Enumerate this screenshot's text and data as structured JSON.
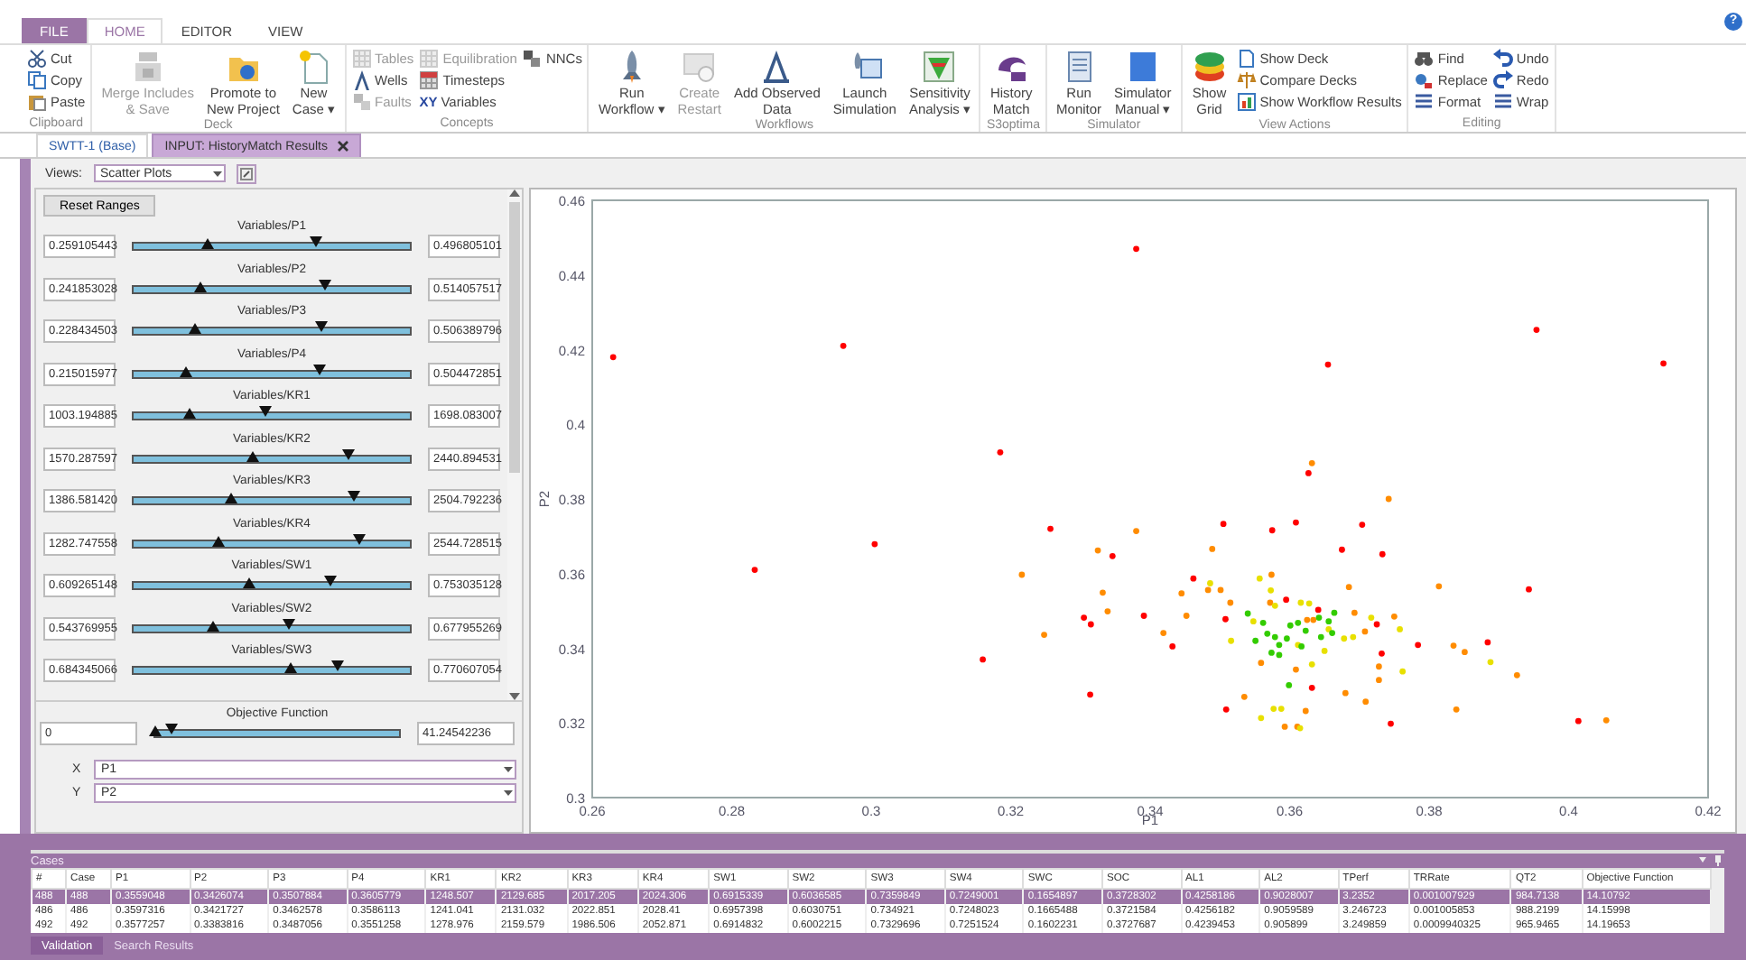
{
  "menu_tabs": [
    {
      "label": "FILE",
      "kind": "file",
      "selected": false
    },
    {
      "label": "HOME",
      "kind": "tab",
      "selected": true
    },
    {
      "label": "EDITOR",
      "kind": "tab",
      "selected": false
    },
    {
      "label": "VIEW",
      "kind": "tab",
      "selected": false
    }
  ],
  "help": "?",
  "ribbon": {
    "groups": [
      {
        "label": "Clipboard",
        "items": [
          {
            "kind": "stack",
            "items": [
              {
                "label": "Cut",
                "disabled": false
              },
              {
                "label": "Copy",
                "disabled": false
              },
              {
                "label": "Paste",
                "disabled": false
              }
            ]
          }
        ]
      },
      {
        "label": "Deck",
        "items": [
          {
            "kind": "large",
            "label": "Merge Includes\n& Save",
            "disabled": true
          },
          {
            "kind": "large",
            "label": "Promote to\nNew Project",
            "disabled": false
          },
          {
            "kind": "large",
            "label": "New\nCase ▾",
            "disabled": false
          }
        ]
      },
      {
        "label": "Concepts",
        "items": [
          {
            "kind": "stack",
            "items": [
              {
                "label": "Tables",
                "disabled": true
              },
              {
                "label": "Wells",
                "disabled": false
              },
              {
                "label": "Faults",
                "disabled": true
              }
            ]
          },
          {
            "kind": "stack",
            "items": [
              {
                "label": "Equilibration",
                "disabled": true
              },
              {
                "label": "Timesteps",
                "disabled": false
              },
              {
                "label": "Variables",
                "disabled": false,
                "glyph": "XY"
              }
            ]
          },
          {
            "kind": "stack",
            "items": [
              {
                "label": "NNCs",
                "disabled": false
              }
            ]
          }
        ]
      },
      {
        "label": "Workflows",
        "items": [
          {
            "kind": "large",
            "label": "Run\nWorkflow ▾",
            "disabled": false
          },
          {
            "kind": "large",
            "label": "Create\nRestart",
            "disabled": true
          },
          {
            "kind": "large",
            "label": "Add Observed\nData",
            "disabled": false
          },
          {
            "kind": "large",
            "label": "Launch\nSimulation",
            "disabled": false
          },
          {
            "kind": "large",
            "label": "Sensitivity\nAnalysis ▾",
            "disabled": false
          }
        ]
      },
      {
        "label": "S3optima",
        "items": [
          {
            "kind": "large",
            "label": "History\nMatch",
            "disabled": false
          }
        ]
      },
      {
        "label": "Simulator",
        "items": [
          {
            "kind": "large",
            "label": "Run\nMonitor",
            "disabled": false
          },
          {
            "kind": "large",
            "label": "Simulator\nManual ▾",
            "disabled": false
          }
        ]
      },
      {
        "label": "View Actions",
        "items": [
          {
            "kind": "large",
            "label": "Show\nGrid",
            "disabled": false
          },
          {
            "kind": "stack",
            "items": [
              {
                "label": "Show Deck",
                "disabled": false
              },
              {
                "label": "Compare Decks",
                "disabled": false
              },
              {
                "label": "Show Workflow Results",
                "disabled": false
              }
            ]
          }
        ]
      },
      {
        "label": "Editing",
        "items": [
          {
            "kind": "stack",
            "items": [
              {
                "label": "Find",
                "disabled": false
              },
              {
                "label": "Replace",
                "disabled": false
              },
              {
                "label": "Format",
                "disabled": false
              }
            ]
          },
          {
            "kind": "stack",
            "items": [
              {
                "label": "Undo",
                "disabled": false
              },
              {
                "label": "Redo",
                "disabled": false
              },
              {
                "label": "Wrap",
                "disabled": false
              }
            ]
          }
        ]
      }
    ]
  },
  "doc_tabs": [
    {
      "label": "SWTT-1 (Base)",
      "selected": false,
      "closable": false
    },
    {
      "label": "INPUT: HistoryMatch Results",
      "selected": true,
      "closable": true
    }
  ],
  "views": {
    "label": "Views:",
    "value": "Scatter Plots"
  },
  "reset_button": "Reset Ranges",
  "sliders": [
    {
      "label": "Variables/P1",
      "min": "0.259105443",
      "max": "0.496805101",
      "thumbs": [
        {
          "kind": "low",
          "level": 0.27
        },
        {
          "kind": "high",
          "level": 0.66
        }
      ]
    },
    {
      "label": "Variables/P2",
      "min": "0.241853028",
      "max": "0.514057517",
      "thumbs": [
        {
          "kind": "low",
          "level": 0.24
        },
        {
          "kind": "high",
          "level": 0.69
        }
      ]
    },
    {
      "label": "Variables/P3",
      "min": "0.228434503",
      "max": "0.506389796",
      "thumbs": [
        {
          "kind": "low",
          "level": 0.22
        },
        {
          "kind": "high",
          "level": 0.68
        }
      ]
    },
    {
      "label": "Variables/P4",
      "min": "0.215015977",
      "max": "0.504472851",
      "thumbs": [
        {
          "kind": "low",
          "level": 0.19
        },
        {
          "kind": "high",
          "level": 0.67
        }
      ]
    },
    {
      "label": "Variables/KR1",
      "min": "1003.194885",
      "max": "1698.083007",
      "thumbs": [
        {
          "kind": "low",
          "level": 0.2
        },
        {
          "kind": "high",
          "level": 0.48
        }
      ]
    },
    {
      "label": "Variables/KR2",
      "min": "1570.287597",
      "max": "2440.894531",
      "thumbs": [
        {
          "kind": "low",
          "level": 0.43
        },
        {
          "kind": "high",
          "level": 0.78
        }
      ]
    },
    {
      "label": "Variables/KR3",
      "min": "1386.581420",
      "max": "2504.792236",
      "thumbs": [
        {
          "kind": "low",
          "level": 0.35
        },
        {
          "kind": "high",
          "level": 0.8
        }
      ]
    },
    {
      "label": "Variables/KR4",
      "min": "1282.747558",
      "max": "2544.728515",
      "thumbs": [
        {
          "kind": "low",
          "level": 0.31
        },
        {
          "kind": "high",
          "level": 0.82
        }
      ]
    },
    {
      "label": "Variables/SW1",
      "min": "0.609265148",
      "max": "0.753035128",
      "thumbs": [
        {
          "kind": "low",
          "level": 0.42
        },
        {
          "kind": "high",
          "level": 0.71
        }
      ]
    },
    {
      "label": "Variables/SW2",
      "min": "0.543769955",
      "max": "0.677955269",
      "thumbs": [
        {
          "kind": "low",
          "level": 0.29
        },
        {
          "kind": "high",
          "level": 0.56
        }
      ]
    },
    {
      "label": "Variables/SW3",
      "min": "0.684345066",
      "max": "0.770607054",
      "thumbs": [
        {
          "kind": "low",
          "level": 0.57
        },
        {
          "kind": "high",
          "level": 0.74
        }
      ]
    }
  ],
  "objective": {
    "label": "Objective Function",
    "min": "0",
    "max": "41.24542236",
    "thumbs": [
      {
        "kind": "low",
        "level": 0.0
      },
      {
        "kind": "high",
        "level": 0.07
      }
    ]
  },
  "axes": [
    {
      "label": "X",
      "value": "P1"
    },
    {
      "label": "Y",
      "value": "P2"
    }
  ],
  "chart": {
    "chart_data": {
      "type": "scatter",
      "xlabel": "P1",
      "ylabel": "P2",
      "xlim": [
        0.26,
        0.42
      ],
      "ylim": [
        0.3,
        0.46
      ],
      "xticks": [
        {
          "value": 0.26,
          "label": "0.26"
        },
        {
          "value": 0.28,
          "label": "0.28"
        },
        {
          "value": 0.3,
          "label": "0.3"
        },
        {
          "value": 0.32,
          "label": "0.32"
        },
        {
          "value": 0.34,
          "label": "0.34"
        },
        {
          "value": 0.36,
          "label": "0.36"
        },
        {
          "value": 0.38,
          "label": "0.38"
        },
        {
          "value": 0.4,
          "label": "0.4"
        },
        {
          "value": 0.42,
          "label": "0.42"
        }
      ],
      "yticks": [
        {
          "value": 0.3,
          "label": "0.3"
        },
        {
          "value": 0.32,
          "label": "0.32"
        },
        {
          "value": 0.34,
          "label": "0.34"
        },
        {
          "value": 0.36,
          "label": "0.36"
        },
        {
          "value": 0.38,
          "label": "0.38"
        },
        {
          "value": 0.4,
          "label": "0.4"
        },
        {
          "value": 0.42,
          "label": "0.42"
        },
        {
          "value": 0.44,
          "label": "0.44"
        },
        {
          "value": 0.46,
          "label": "0.46"
        }
      ],
      "series": [
        {
          "color": "#ff0000",
          "x": [
            0.263,
            0.296,
            0.338,
            0.3655,
            0.3954,
            0.4136,
            0.2833,
            0.3005,
            0.316,
            0.3185,
            0.3257,
            0.3305,
            0.3315,
            0.3314,
            0.3346,
            0.3391,
            0.3432,
            0.3462,
            0.3505,
            0.3508,
            0.3509,
            0.3575,
            0.3595,
            0.3609,
            0.3627,
            0.3632,
            0.3641,
            0.3675,
            0.3704,
            0.3725,
            0.3732,
            0.3733,
            0.3745,
            0.3784,
            0.3884,
            0.3943,
            0.4014
          ],
          "values": [
            0.418,
            0.421,
            0.447,
            0.416,
            0.4253,
            0.4163,
            0.361,
            0.3679,
            0.337,
            0.3925,
            0.372,
            0.3482,
            0.3464,
            0.3276,
            0.3647,
            0.3487,
            0.3405,
            0.3587,
            0.3733,
            0.3478,
            0.3236,
            0.3716,
            0.353,
            0.3737,
            0.3869,
            0.3294,
            0.3503,
            0.3664,
            0.3731,
            0.3464,
            0.3386,
            0.3652,
            0.3198,
            0.3409,
            0.3416,
            0.3558,
            0.3205
          ]
        },
        {
          "color": "#ff8c00",
          "x": [
            0.3632,
            0.3742,
            0.338,
            0.3325,
            0.3216,
            0.3332,
            0.3339,
            0.3248,
            0.3419,
            0.3452,
            0.3445,
            0.3489,
            0.3483,
            0.3501,
            0.3515,
            0.3535,
            0.3559,
            0.3574,
            0.3572,
            0.3593,
            0.3611,
            0.3623,
            0.3609,
            0.3625,
            0.368,
            0.3685,
            0.3693,
            0.3708,
            0.3728,
            0.3728,
            0.3709,
            0.375,
            0.3814,
            0.3835,
            0.3851,
            0.3839,
            0.3926,
            0.4054,
            0.3634
          ],
          "values": [
            0.3896,
            0.38,
            0.3714,
            0.3662,
            0.3597,
            0.3549,
            0.3499,
            0.3436,
            0.3441,
            0.3487,
            0.3547,
            0.3666,
            0.3556,
            0.3556,
            0.3522,
            0.327,
            0.3361,
            0.3597,
            0.3522,
            0.319,
            0.319,
            0.3232,
            0.3343,
            0.3476,
            0.328,
            0.3564,
            0.3495,
            0.3445,
            0.3351,
            0.3315,
            0.3257,
            0.3485,
            0.3566,
            0.3407,
            0.339,
            0.3236,
            0.3328,
            0.3207,
            0.3476
          ]
        },
        {
          "color": "#e8e000",
          "x": [
            0.3486,
            0.3557,
            0.3573,
            0.3516,
            0.3559,
            0.3577,
            0.3588,
            0.3615,
            0.3616,
            0.3628,
            0.3656,
            0.3678,
            0.3691,
            0.365,
            0.3758,
            0.3762,
            0.3888,
            0.3579,
            0.3548,
            0.3612,
            0.3632,
            0.3717
          ],
          "values": [
            0.3574,
            0.3587,
            0.3555,
            0.342,
            0.3213,
            0.3238,
            0.3238,
            0.3186,
            0.3522,
            0.352,
            0.3451,
            0.3426,
            0.343,
            0.3393,
            0.3451,
            0.3338,
            0.3363,
            0.3514,
            0.3472,
            0.3409,
            0.3357,
            0.3482
          ]
        },
        {
          "color": "#33cc00",
          "x": [
            0.354,
            0.3562,
            0.3551,
            0.3568,
            0.3579,
            0.3585,
            0.3574,
            0.3585,
            0.3596,
            0.3601,
            0.3612,
            0.3623,
            0.3617,
            0.3599,
            0.3642,
            0.3656,
            0.3664,
            0.3645,
            0.3661
          ],
          "values": [
            0.3493,
            0.3468,
            0.342,
            0.3439,
            0.343,
            0.3409,
            0.3388,
            0.3382,
            0.3426,
            0.3461,
            0.3468,
            0.3447,
            0.3405,
            0.3301,
            0.3482,
            0.3472,
            0.3495,
            0.343,
            0.3441
          ]
        }
      ]
    }
  },
  "cases": {
    "title": "Cases",
    "columns": [
      "#",
      "Case",
      "P1",
      "P2",
      "P3",
      "P4",
      "KR1",
      "KR2",
      "KR3",
      "KR4",
      "SW1",
      "SW2",
      "SW3",
      "SW4",
      "SWC",
      "SOC",
      "AL1",
      "AL2",
      "TPerf",
      "TRRate",
      "QT2",
      "Objective Function"
    ],
    "rows": [
      {
        "selected": true,
        "cells": [
          "488",
          "488",
          "0.3559048",
          "0.3426074",
          "0.3507884",
          "0.3605779",
          "1248.507",
          "2129.685",
          "2017.205",
          "2024.306",
          "0.6915339",
          "0.6036585",
          "0.7359849",
          "0.7249001",
          "0.1654897",
          "0.3728302",
          "0.4258186",
          "0.9028007",
          "3.2352",
          "0.001007929",
          "984.7138",
          "14.10792"
        ]
      },
      {
        "selected": false,
        "cells": [
          "486",
          "486",
          "0.3597316",
          "0.3421727",
          "0.3462578",
          "0.3586113",
          "1241.041",
          "2131.032",
          "2022.851",
          "2028.41",
          "0.6957398",
          "0.6030751",
          "0.734921",
          "0.7248023",
          "0.1665488",
          "0.3721584",
          "0.4256182",
          "0.9059589",
          "3.246723",
          "0.001005853",
          "988.2199",
          "14.15998"
        ]
      },
      {
        "selected": false,
        "cells": [
          "492",
          "492",
          "0.3577257",
          "0.3383816",
          "0.3487056",
          "0.3551258",
          "1278.976",
          "2159.579",
          "1986.506",
          "2052.871",
          "0.6914832",
          "0.6002215",
          "0.7329696",
          "0.7251524",
          "0.1602231",
          "0.3727687",
          "0.4239453",
          "0.905899",
          "3.249859",
          "0.0009940325",
          "965.9465",
          "14.19653"
        ]
      }
    ]
  },
  "bottom_tabs": [
    {
      "label": "Validation",
      "selected": true
    },
    {
      "label": "Search Results",
      "selected": false
    }
  ]
}
